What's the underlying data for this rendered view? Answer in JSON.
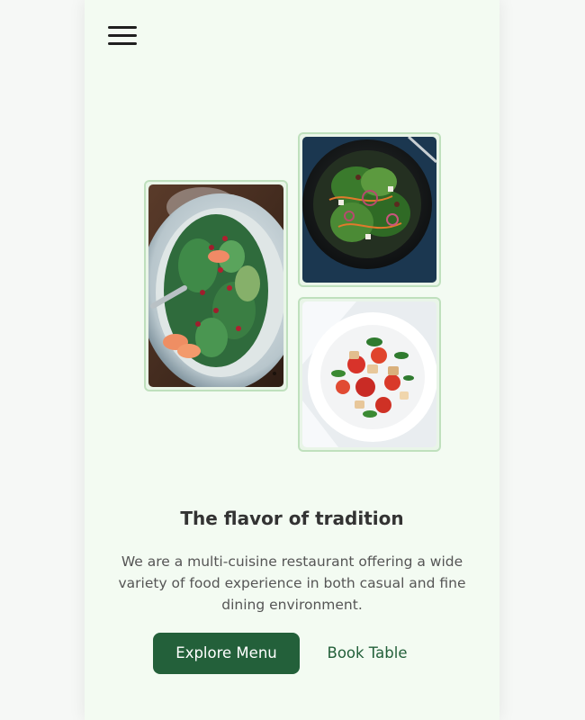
{
  "header": {
    "menu_icon": "hamburger-menu-icon"
  },
  "gallery": {
    "images": [
      {
        "alt": "salad-platter-with-pomegranate"
      },
      {
        "alt": "green-salad-bowl"
      },
      {
        "alt": "tomato-bread-salad-plate"
      }
    ]
  },
  "hero": {
    "title": "The flavor of tradition",
    "description": "We are a multi-cuisine restaurant offering a wide variety of food experience in both casual and fine dining environment."
  },
  "actions": {
    "primary_label": "Explore Menu",
    "secondary_label": "Book Table"
  },
  "colors": {
    "page_bg": "#f6f8f6",
    "panel_bg": "#f3fbf2",
    "accent": "#23603a",
    "image_border": "#bfe0bd",
    "title_text": "#333333",
    "body_text": "#555555"
  }
}
